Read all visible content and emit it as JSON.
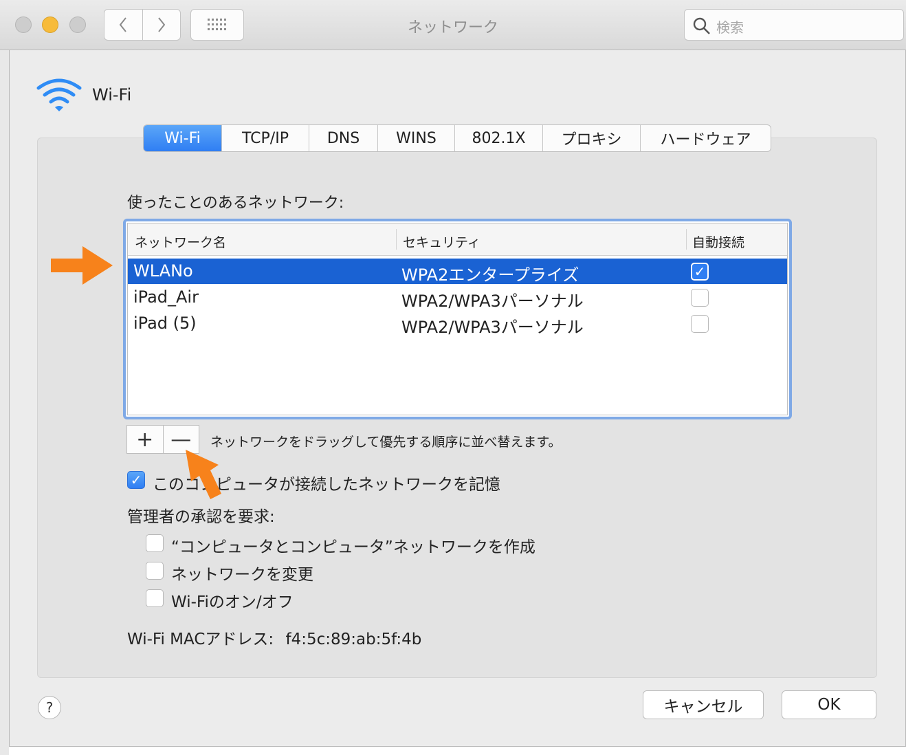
{
  "window": {
    "title": "ネットワーク",
    "search_placeholder": "検索",
    "back_glyph": "‹",
    "forward_glyph": "›"
  },
  "interface": {
    "name": "Wi-Fi",
    "icon": "wifi-icon"
  },
  "tabs": [
    {
      "label": "Wi-Fi",
      "active": true
    },
    {
      "label": "TCP/IP",
      "active": false
    },
    {
      "label": "DNS",
      "active": false
    },
    {
      "label": "WINS",
      "active": false
    },
    {
      "label": "802.1X",
      "active": false
    },
    {
      "label": "プロキシ",
      "active": false
    },
    {
      "label": "ハードウェア",
      "active": false
    }
  ],
  "networks_section": {
    "label": "使ったことのあるネットワーク:",
    "columns": [
      "ネットワーク名",
      "セキュリティ",
      "自動接続"
    ],
    "rows": [
      {
        "name": "WLANo",
        "security": "WPA2エンタープライズ",
        "auto_join": true,
        "selected": true
      },
      {
        "name": "iPad_Air",
        "security": "WPA2/WPA3パーソナル",
        "auto_join": false,
        "selected": false
      },
      {
        "name": "iPad (5)",
        "security": "WPA2/WPA3パーソナル",
        "auto_join": false,
        "selected": false
      }
    ],
    "add_label": "+",
    "remove_label": "—",
    "hint": "ネットワークをドラッグして優先する順序に並べ替えます。"
  },
  "remember_option": {
    "label": "このコンピュータが接続したネットワークを記憶",
    "checked": true
  },
  "admin_section": {
    "label": "管理者の承認を要求:",
    "options": [
      {
        "label": "“コンピュータとコンピュータ”ネットワークを作成",
        "checked": false
      },
      {
        "label": "ネットワークを変更",
        "checked": false
      },
      {
        "label": "Wi-Fiのオン/オフ",
        "checked": false
      }
    ]
  },
  "mac_address": {
    "label": "Wi-Fi MACアドレス:",
    "value": "f4:5c:89:ab:5f:4b"
  },
  "buttons": {
    "help": "?",
    "cancel": "キャンセル",
    "ok": "OK"
  },
  "colors": {
    "accent": "#2f7ef3",
    "selection": "#1a62d3",
    "annotation_arrow": "#f7821b",
    "wifi_icon": "#2f8cf5"
  }
}
